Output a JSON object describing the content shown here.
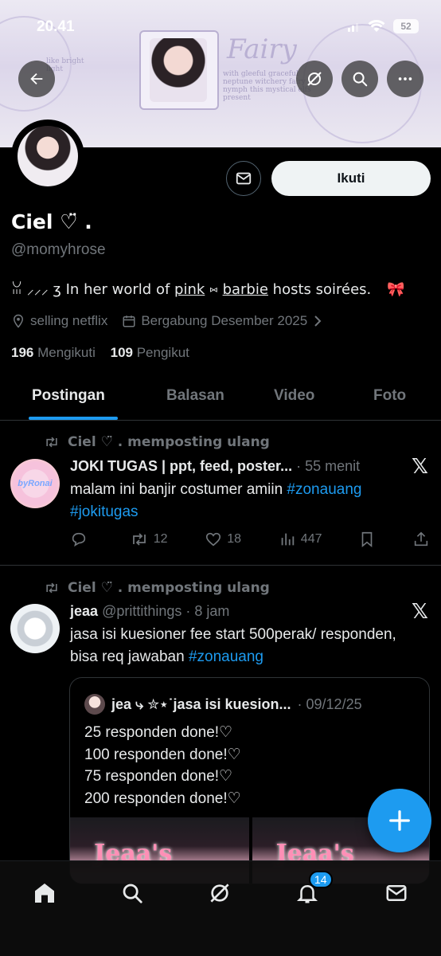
{
  "status_bar": {
    "time": "20.41",
    "battery": "52"
  },
  "banner": {
    "title_text": "Fairy",
    "scribble_right": "with gleeful graceful neptune witchery fairy en nymph this mystical elfs present",
    "scribble_left": "like bright light"
  },
  "profile": {
    "display_name": "Ciel ♡̈ .",
    "handle": "@momyhrose",
    "bio": {
      "prefix": "ꈍ ⸝⸝⸝ ʒ   In her world of",
      "pink": "pink",
      "sep": " ⑅ ",
      "barbie": "barbie",
      "suffix": "hosts soirées.",
      "bow": "🎀"
    },
    "location": "selling netflix",
    "joined": "Bergabung Desember 2025",
    "following_count": "196",
    "following_label": "Mengikuti",
    "followers_count": "109",
    "followers_label": "Pengikut",
    "follow_button": "Ikuti"
  },
  "tabs": [
    "Postingan",
    "Balasan",
    "Video",
    "Foto"
  ],
  "posts": [
    {
      "repost_text": "Ciel ♡̈ . memposting ulang",
      "author": "JOKI TUGAS | ppt, feed, poster...",
      "time": "· 55 menit",
      "text_main": "malam ini banjir costumer amiin ",
      "tag1": "#zonauang",
      "tag2": "#jokitugas",
      "replies": "",
      "reposts": "12",
      "likes": "18",
      "views": "447",
      "avatar_label": "byRonai"
    },
    {
      "repost_text": "Ciel ♡̈ . memposting ulang",
      "author": "jeaa",
      "handle": "@prittithings",
      "time": "· 8 jam",
      "text_main": "jasa isi kuesioner fee start 500perak/ responden, bisa req jawaban ",
      "tag1": "#zonauang",
      "quote": {
        "author": "jea ⤷ ✮⋆˙jasa isi kuesion...",
        "date": "· 09/12/25",
        "lines": [
          "25 responden done!♡",
          "100 responden done!♡",
          "75 responden done!♡",
          "200 responden done!♡"
        ],
        "media_text": "Jeaa's"
      }
    }
  ],
  "nav": {
    "notifications_badge": "14"
  },
  "colors": {
    "accent": "#1d9bf0",
    "muted": "#71767b",
    "text": "#e7e9ea",
    "border": "#2f3336"
  }
}
